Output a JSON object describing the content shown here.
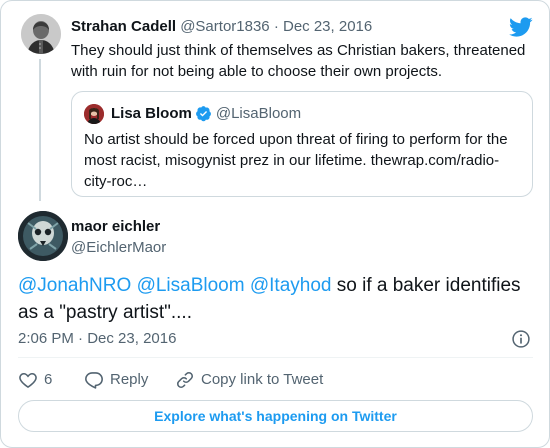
{
  "parent": {
    "name": "Strahan Cadell",
    "handle": "@Sartor1836",
    "separator": "·",
    "date": "Dec 23, 2016",
    "text": "They should just think of themselves as Christian bakers, threatened with ruin for not being able to choose their own projects.",
    "avatar_icon": "portrait-avatar"
  },
  "quote": {
    "name": "Lisa Bloom",
    "handle": "@LisaBloom",
    "verified": true,
    "text": "No artist should be forced upon threat of firing to perform for the most racist, misogynist prez in our lifetime. thewrap.com/radio-city-roc…"
  },
  "main": {
    "name": "maor eichler",
    "handle": "@EichlerMaor",
    "mentions": [
      "@JonahNRO",
      "@LisaBloom",
      "@Itayhod"
    ],
    "text_rest": " so if a baker identifies as a \"pastry artist\"....",
    "time": "2:06 PM",
    "separator": "·",
    "date": "Dec 23, 2016"
  },
  "actions": {
    "like_count": "6",
    "reply_label": "Reply",
    "copy_label": "Copy link to Tweet"
  },
  "explore_label": "Explore what's happening on Twitter",
  "colors": {
    "accent": "#1d9bf0",
    "text": "#0f1419",
    "secondary": "#536471",
    "border": "#cfd9de"
  }
}
